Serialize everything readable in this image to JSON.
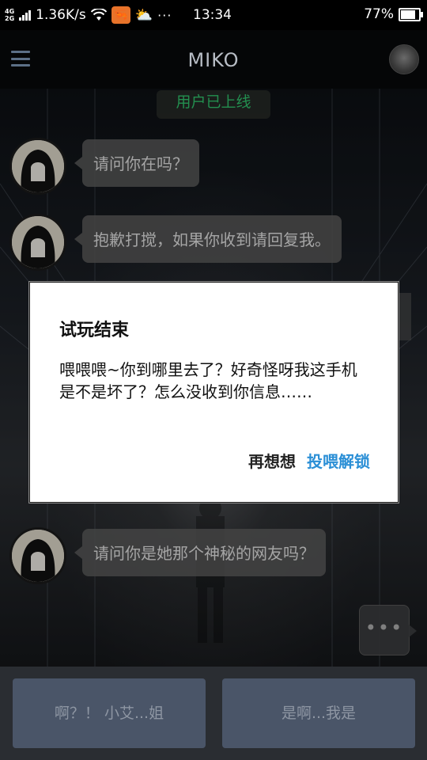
{
  "status_bar": {
    "network": "4G\n2G",
    "speed": "1.36K/s",
    "time": "13:34",
    "battery": "77%",
    "battery_level": 0.77,
    "dots": "···"
  },
  "header": {
    "title": "MIKO"
  },
  "chat": {
    "system_message": "用户已上线",
    "messages": [
      {
        "text": "请问你在吗？"
      },
      {
        "text": "抱歉打搅，如果你收到请回复我。"
      },
      {
        "text": "请问你是她那个神秘的网友吗？"
      }
    ],
    "typing": "•••"
  },
  "dialog": {
    "title": "试玩结束",
    "message": "喂喂喂~你到哪里去了？好奇怪呀我这手机是不是坏了？怎么没收到你信息……",
    "negative": "再想想",
    "positive": "投喂解锁"
  },
  "choices": [
    {
      "label": "啊？！ 小艾...姐"
    },
    {
      "label": "是啊...我是"
    }
  ],
  "colors": {
    "accent": "#2b8fd6",
    "system_green": "#2fbf6a",
    "choice_bg": "#4a5568"
  }
}
